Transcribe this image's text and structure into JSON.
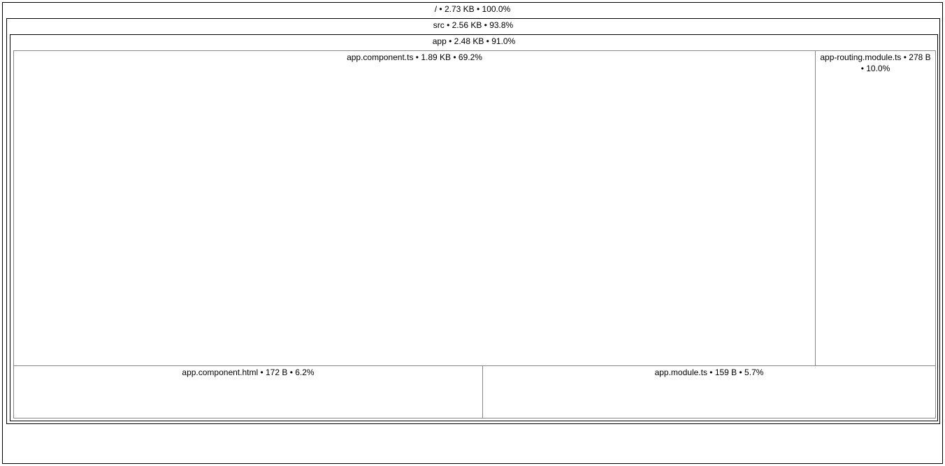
{
  "root": {
    "label": "/ • 2.73 KB • 100.0%"
  },
  "src": {
    "label": "src • 2.56 KB • 93.8%"
  },
  "app": {
    "label": "app • 2.48 KB • 91.0%"
  },
  "files": {
    "app_component_ts": {
      "label": "app.component.ts • 1.89 KB • 69.2%"
    },
    "app_routing": {
      "label": "app-routing.module.ts • 278 B • 10.0%"
    },
    "app_component_html": {
      "label": "app.component.html • 172 B • 6.2%"
    },
    "app_module": {
      "label": "app.module.ts • 159 B • 5.7%"
    }
  },
  "chart_data": {
    "type": "treemap",
    "total_bytes": 2795,
    "nodes": [
      {
        "path": "/",
        "size": "2.73 KB",
        "percent": 100.0,
        "children": [
          {
            "path": "src",
            "size": "2.56 KB",
            "percent": 93.8,
            "children": [
              {
                "path": "app",
                "size": "2.48 KB",
                "percent": 91.0,
                "children": [
                  {
                    "path": "app.component.ts",
                    "size": "1.89 KB",
                    "bytes": 1935,
                    "percent": 69.2
                  },
                  {
                    "path": "app-routing.module.ts",
                    "size": "278 B",
                    "bytes": 278,
                    "percent": 10.0
                  },
                  {
                    "path": "app.component.html",
                    "size": "172 B",
                    "bytes": 172,
                    "percent": 6.2
                  },
                  {
                    "path": "app.module.ts",
                    "size": "159 B",
                    "bytes": 159,
                    "percent": 5.7
                  }
                ]
              }
            ]
          }
        ]
      }
    ]
  }
}
